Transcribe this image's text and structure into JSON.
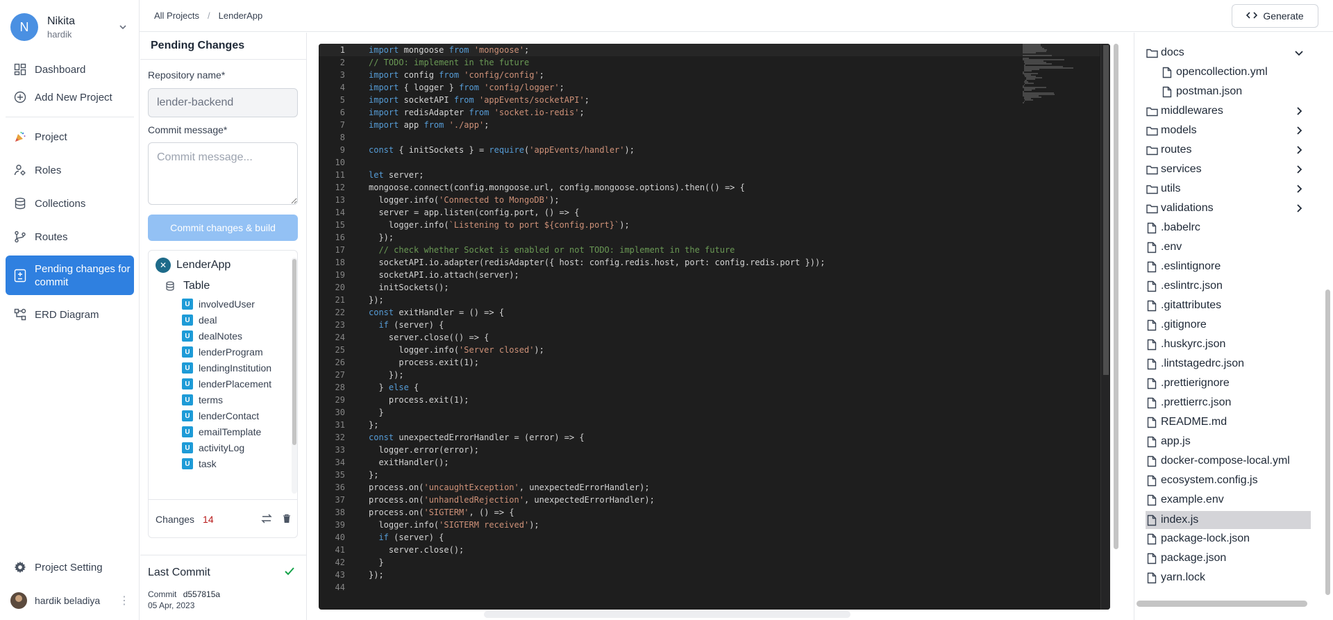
{
  "account": {
    "initial": "N",
    "name": "Nikita",
    "username": "hardik"
  },
  "nav": [
    {
      "id": "dashboard",
      "label": "Dashboard",
      "icon": "dashboard-icon"
    },
    {
      "id": "add-project",
      "label": "Add New Project",
      "icon": "plus-circle-icon"
    },
    {
      "id": "project",
      "label": "Project",
      "icon": "party-popper-icon"
    },
    {
      "id": "roles",
      "label": "Roles",
      "icon": "user-gear-icon"
    },
    {
      "id": "collections",
      "label": "Collections",
      "icon": "database-icon"
    },
    {
      "id": "routes",
      "label": "Routes",
      "icon": "git-branch-icon"
    },
    {
      "id": "pending",
      "label": "Pending changes for commit",
      "icon": "document-changes-icon",
      "active": true
    },
    {
      "id": "erd",
      "label": "ERD Diagram",
      "icon": "diagram-icon"
    }
  ],
  "project_setting": "Project Setting",
  "user": {
    "name": "hardik beladiya"
  },
  "breadcrumb": {
    "root": "All Projects",
    "current": "LenderApp"
  },
  "generate_label": "Generate",
  "pending": {
    "title": "Pending Changes",
    "repo_label": "Repository name*",
    "repo_value": "lender-backend",
    "commit_label": "Commit message*",
    "commit_placeholder": "Commit message...",
    "commit_button": "Commit changes & build",
    "app_name": "LenderApp",
    "table_label": "Table",
    "badge": "U",
    "entities": [
      "involvedUser",
      "deal",
      "dealNotes",
      "lenderProgram",
      "lendingInstitution",
      "lenderPlacement",
      "terms",
      "lenderContact",
      "emailTemplate",
      "activityLog",
      "task"
    ],
    "changes_label": "Changes",
    "changes_count": "14",
    "last_commit_title": "Last Commit",
    "commit_prefix": "Commit",
    "commit_hash": "d557815a",
    "commit_date": "05 Apr, 2023"
  },
  "editor": {
    "current_line": 1,
    "lines": [
      "import mongoose from 'mongoose';",
      "// TODO: implement in the future",
      "import config from 'config/config';",
      "import { logger } from 'config/logger';",
      "import socketAPI from 'appEvents/socketAPI';",
      "import redisAdapter from 'socket.io-redis';",
      "import app from './app';",
      "",
      "const { initSockets } = require('appEvents/handler');",
      "",
      "let server;",
      "mongoose.connect(config.mongoose.url, config.mongoose.options).then(() => {",
      "  logger.info('Connected to MongoDB');",
      "  server = app.listen(config.port, () => {",
      "    logger.info(`Listening to port ${config.port}`);",
      "  });",
      "  // check whether Socket is enabled or not TODO: implement in the future",
      "  socketAPI.io.adapter(redisAdapter({ host: config.redis.host, port: config.redis.port }));",
      "  socketAPI.io.attach(server);",
      "  initSockets();",
      "});",
      "const exitHandler = () => {",
      "  if (server) {",
      "    server.close(() => {",
      "      logger.info('Server closed');",
      "      process.exit(1);",
      "    });",
      "  } else {",
      "    process.exit(1);",
      "  }",
      "};",
      "const unexpectedErrorHandler = (error) => {",
      "  logger.error(error);",
      "  exitHandler();",
      "};",
      "process.on('uncaughtException', unexpectedErrorHandler);",
      "process.on('unhandledRejection', unexpectedErrorHandler);",
      "process.on('SIGTERM', () => {",
      "  logger.info('SIGTERM received');",
      "  if (server) {",
      "    server.close();",
      "  }",
      "});",
      ""
    ]
  },
  "filetree": [
    {
      "name": "docs",
      "type": "folder",
      "expanded": true,
      "depth": 0
    },
    {
      "name": "opencollection.yml",
      "type": "file",
      "depth": 1
    },
    {
      "name": "postman.json",
      "type": "file",
      "depth": 1
    },
    {
      "name": "middlewares",
      "type": "folder",
      "depth": 0
    },
    {
      "name": "models",
      "type": "folder",
      "depth": 0
    },
    {
      "name": "routes",
      "type": "folder",
      "depth": 0
    },
    {
      "name": "services",
      "type": "folder",
      "depth": 0
    },
    {
      "name": "utils",
      "type": "folder",
      "depth": 0
    },
    {
      "name": "validations",
      "type": "folder",
      "depth": 0
    },
    {
      "name": ".babelrc",
      "type": "file",
      "depth": 0
    },
    {
      "name": ".env",
      "type": "file",
      "depth": 0
    },
    {
      "name": ".eslintignore",
      "type": "file",
      "depth": 0
    },
    {
      "name": ".eslintrc.json",
      "type": "file",
      "depth": 0
    },
    {
      "name": ".gitattributes",
      "type": "file",
      "depth": 0
    },
    {
      "name": ".gitignore",
      "type": "file",
      "depth": 0
    },
    {
      "name": ".huskyrc.json",
      "type": "file",
      "depth": 0
    },
    {
      "name": ".lintstagedrc.json",
      "type": "file",
      "depth": 0
    },
    {
      "name": ".prettierignore",
      "type": "file",
      "depth": 0
    },
    {
      "name": ".prettierrc.json",
      "type": "file",
      "depth": 0
    },
    {
      "name": "README.md",
      "type": "file",
      "depth": 0
    },
    {
      "name": "app.js",
      "type": "file",
      "depth": 0
    },
    {
      "name": "docker-compose-local.yml",
      "type": "file",
      "depth": 0
    },
    {
      "name": "ecosystem.config.js",
      "type": "file",
      "depth": 0
    },
    {
      "name": "example.env",
      "type": "file",
      "depth": 0
    },
    {
      "name": "index.js",
      "type": "file",
      "depth": 0,
      "selected": true
    },
    {
      "name": "package-lock.json",
      "type": "file",
      "depth": 0
    },
    {
      "name": "package.json",
      "type": "file",
      "depth": 0
    },
    {
      "name": "yarn.lock",
      "type": "file",
      "depth": 0
    }
  ],
  "colors": {
    "accent": "#2f80e0",
    "editor_bg": "#1e1e1e",
    "keyword": "#569cd6",
    "string": "#ce9178",
    "comment": "#6a9955",
    "changes_count": "#b91c1c",
    "badge": "#1e9bd7",
    "success": "#16a34a"
  }
}
